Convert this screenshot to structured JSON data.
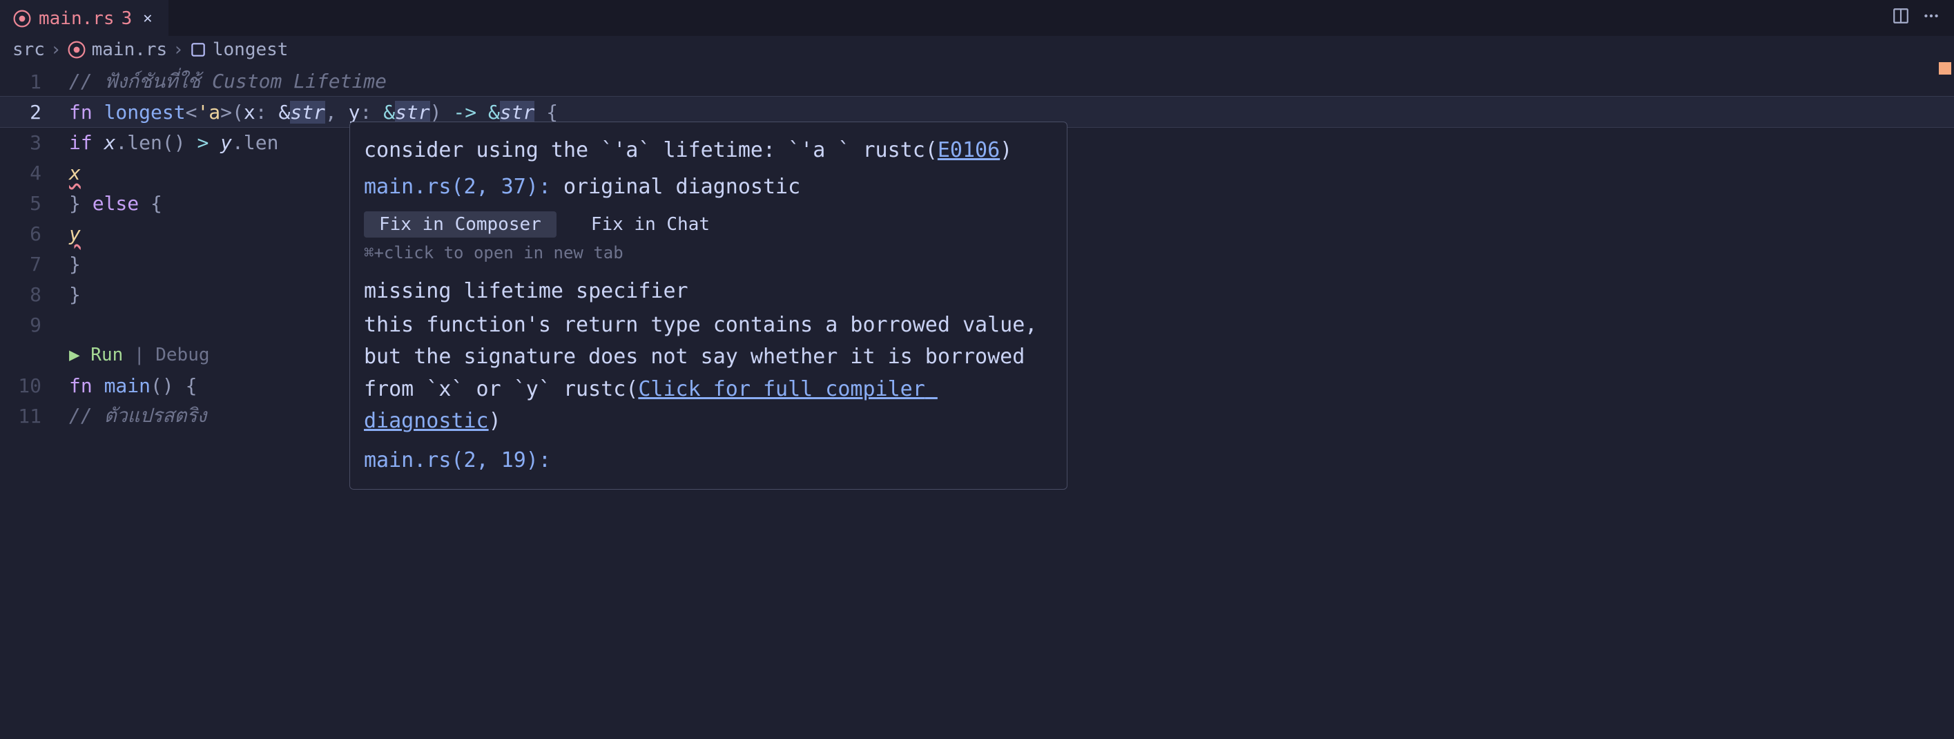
{
  "tab": {
    "filename": "main.rs",
    "dirty_count": "3",
    "close_title": "Close"
  },
  "breadcrumbs": {
    "seg1": "src",
    "seg2": "main.rs",
    "seg3": "longest"
  },
  "lines": {
    "l1": "1",
    "l2": "2",
    "l3": "3",
    "l4": "4",
    "l5": "5",
    "l6": "6",
    "l7": "7",
    "l8": "8",
    "l9": "9",
    "l10": "10",
    "l11": "11"
  },
  "code": {
    "comment1": "// ฟังก์ชันที่ใช้ Custom Lifetime",
    "fn_kw": "fn ",
    "fn_name": "longest",
    "lt_open": "<",
    "lt": "'a",
    "lt_close": ">",
    "paren_open": "(",
    "x": "x",
    "colon": ": ",
    "amp": "&",
    "str": "str",
    "comma": ", ",
    "y": "y",
    "paren_close": ") ",
    "arrow": "-> ",
    "brace_open": " {",
    "if_kw": "if ",
    "x_var": "x",
    "dot_len": ".len() ",
    "gt": "> ",
    "y_var": "y",
    "dot_len2": ".len",
    "x_ret": "x",
    "else_kw": "} else {",
    "y_ret": "y",
    "close_brace": "}",
    "close_brace2": "}",
    "codelens_run": "▶ Run",
    "codelens_sep": " | ",
    "codelens_debug": "Debug",
    "fn_main": "main",
    "main_sig": "() {",
    "comment2": "// ตัวแปรสตริง"
  },
  "hover": {
    "line1_pre": "consider using the `",
    "line1_lt": "'a",
    "line1_mid": "` lifetime: `",
    "line1_lt2": "'a ",
    "line1_post": "` rustc(",
    "line1_err": "E0106",
    "line1_close": ")",
    "loc": "main.rs(2, 37): ",
    "loc_msg": "original diagnostic",
    "btn_composer": "Fix in Composer",
    "btn_chat": "Fix in Chat",
    "hint": "⌘+click to open in new tab",
    "body_title": "missing lifetime specifier",
    "body_text": "this function's return type contains a borrowed value, but the signature does not say whether it is borrowed from `x` or `y` rustc(",
    "body_link": "Click for full compiler diagnostic",
    "body_close": ")",
    "loc2": "main.rs(2, 19):"
  }
}
